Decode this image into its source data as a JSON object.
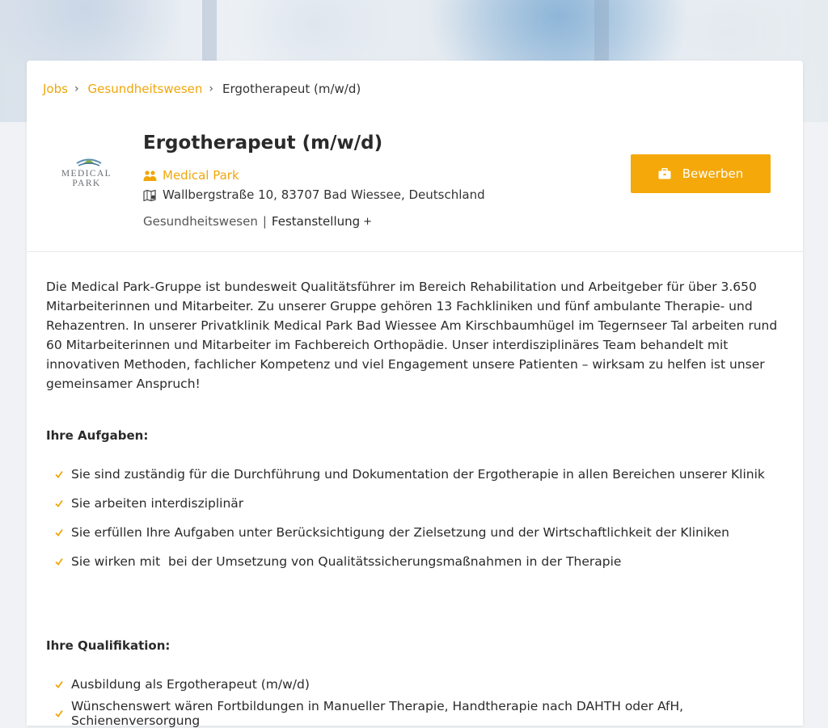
{
  "breadcrumb": {
    "items": [
      "Jobs",
      "Gesundheitswesen"
    ],
    "current": "Ergotherapeut (m/w/d)"
  },
  "logo": {
    "text": "MEDICAL PARK"
  },
  "job": {
    "title": "Ergotherapeut (m/w/d)",
    "company": "Medical Park",
    "address": "Wallbergstraße 10, 83707 Bad Wiessee, Deutschland",
    "category": "Gesundheitswesen",
    "separator": "|",
    "employment": "Festanstellung",
    "employment_more": "+"
  },
  "apply": {
    "label": "Bewerben"
  },
  "intro": "Die Medical Park-Gruppe ist bundesweit Qualitätsführer im Bereich Rehabilitation und Arbeitgeber für über 3.650 Mitarbeiterinnen und Mitarbeiter. Zu unserer Gruppe gehören 13 Fachkliniken und fünf ambulante Therapie- und Rehazentren. In unserer Privatklinik Medical Park Bad Wiessee Am Kirschbaumhügel im Tegernseer Tal arbeiten rund 60 Mitarbeiterinnen und Mitarbeiter im Fachbereich Orthopädie. Unser interdisziplinäres Team behandelt mit innovativen Methoden, fachlicher Kompetenz und viel Engagement unsere Patienten – wirksam zu helfen ist unser gemeinsamer Anspruch!",
  "tasks": {
    "heading": "Ihre Aufgaben:",
    "items": [
      "Sie sind zuständig für die Durchführung und Dokumentation der Ergotherapie in allen Bereichen unserer Klinik",
      "Sie arbeiten interdisziplinär",
      "Sie erfüllen Ihre Aufgaben unter Berücksichtigung der Zielsetzung und der Wirtschaftlichkeit der Kliniken",
      "Sie wirken mit  bei der Umsetzung von Qualitätssicherungsmaßnahmen in der Therapie"
    ]
  },
  "qualifications": {
    "heading": "Ihre Qualifikation:",
    "items": [
      "Ausbildung als Ergotherapeut (m/w/d)",
      "Wünschenswert wären Fortbildungen in Manueller Therapie, Handtherapie nach DAHTH oder AfH, Schienenversorgung"
    ]
  },
  "colors": {
    "accent": "#f5a80a",
    "link": "#f0a60a",
    "text": "#2a2a2a",
    "page_bg": "#f0f2f5"
  },
  "icons": {
    "breadcrumb_separator": "chevron-right-icon",
    "company": "company-people-icon",
    "address": "map-pin-icon",
    "apply": "briefcase-icon",
    "list_bullet": "checkmark-icon"
  }
}
